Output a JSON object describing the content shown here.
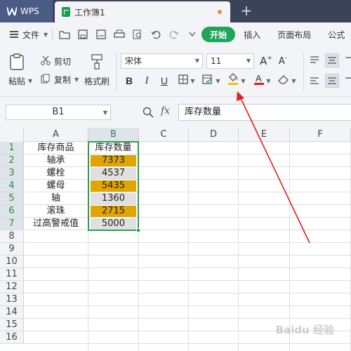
{
  "titlebar": {
    "app_label": "WPS",
    "doc_tab": "工作簿1",
    "new_tab_icon": "plus-icon"
  },
  "menubar": {
    "file_label": "文件",
    "ribbon_tabs": [
      "开始",
      "插入",
      "页面布局",
      "公式"
    ],
    "active_tab": "开始",
    "accent_color": "#20a35a"
  },
  "ribbon": {
    "paste_label": "粘贴",
    "cut_label": "剪切",
    "copy_label": "复制",
    "format_painter_label": "格式刷",
    "font_name": "宋体",
    "font_size": "11",
    "bold": "B",
    "italic": "I",
    "underline": "U",
    "font_color": "#e02020",
    "fill_color": "#f2c200"
  },
  "formula_bar": {
    "name_box": "B1",
    "fx_label": "fx",
    "formula_value": "库存数量"
  },
  "sheet": {
    "columns": [
      "A",
      "B",
      "C",
      "D",
      "E",
      "F"
    ],
    "selected_column": "B",
    "row_numbers": [
      "1",
      "2",
      "3",
      "4",
      "5",
      "6",
      "7",
      "8",
      "9",
      "10",
      "11",
      "12",
      "13",
      "14",
      "15",
      "16"
    ],
    "rows": [
      {
        "a": "库存商品",
        "b": "库存数量"
      },
      {
        "a": "轴承",
        "b": "7373"
      },
      {
        "a": "螺栓",
        "b": "4537"
      },
      {
        "a": "螺母",
        "b": "5435"
      },
      {
        "a": "轴",
        "b": "1360"
      },
      {
        "a": "滚珠",
        "b": "2715"
      },
      {
        "a": "过高警戒值",
        "b": "5000"
      }
    ],
    "highlight_color": "#e0a500",
    "selection_color": "#2f9e4f"
  },
  "watermark": "Baidu 经验",
  "annotation": {
    "arrow_color": "#e0201c"
  }
}
